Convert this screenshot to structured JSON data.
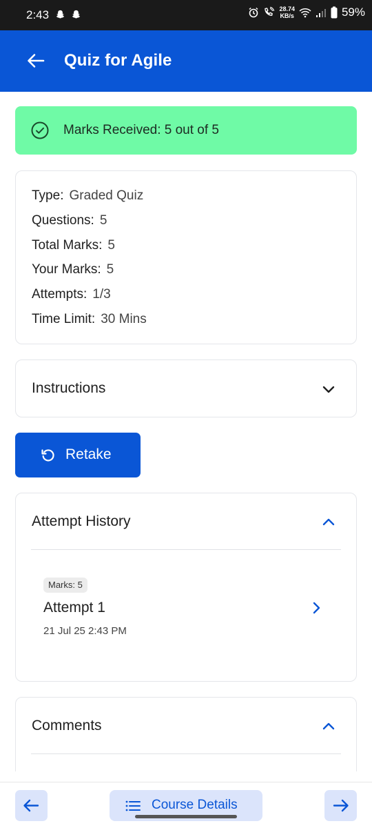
{
  "status_bar": {
    "time": "2:43",
    "network_speed_value": "28.74",
    "network_speed_unit": "KB/s",
    "battery": "59%",
    "icons": [
      "snapchat-icon",
      "snapchat-icon",
      "alarm-icon",
      "wifi-calling-icon",
      "wifi-icon",
      "signal-icon",
      "battery-icon"
    ]
  },
  "app_bar": {
    "title": "Quiz for Agile",
    "back_icon": "arrow-left-icon",
    "background": "#0a56d6"
  },
  "marks_banner": {
    "text": "Marks Received: 5 out of 5",
    "icon": "check-circle-icon",
    "background": "#6ffaa6"
  },
  "quiz_info": [
    {
      "label": "Type:",
      "value": "Graded Quiz"
    },
    {
      "label": "Questions:",
      "value": "5"
    },
    {
      "label": "Total Marks:",
      "value": "5"
    },
    {
      "label": "Your Marks:",
      "value": "5"
    },
    {
      "label": "Attempts:",
      "value": "1/3"
    },
    {
      "label": "Time Limit:",
      "value": "30 Mins"
    }
  ],
  "instructions": {
    "title": "Instructions",
    "icon": "chevron-down-icon"
  },
  "retake": {
    "label": "Retake",
    "icon": "retake-icon"
  },
  "attempt_history": {
    "title": "Attempt History",
    "icon": "chevron-up-icon",
    "attempts": [
      {
        "marks_badge": "Marks: 5",
        "title": "Attempt 1",
        "date": "21 Jul 25 2:43 PM"
      }
    ]
  },
  "comments": {
    "title": "Comments",
    "icon": "chevron-up-icon"
  },
  "bottom_nav": {
    "prev_icon": "arrow-left-icon",
    "course_details_label": "Course Details",
    "course_details_icon": "list-icon",
    "next_icon": "arrow-right-icon"
  },
  "colors": {
    "accent": "#0a56d6",
    "success": "#6ffaa6",
    "nav_button_bg": "#dbe4fb"
  }
}
